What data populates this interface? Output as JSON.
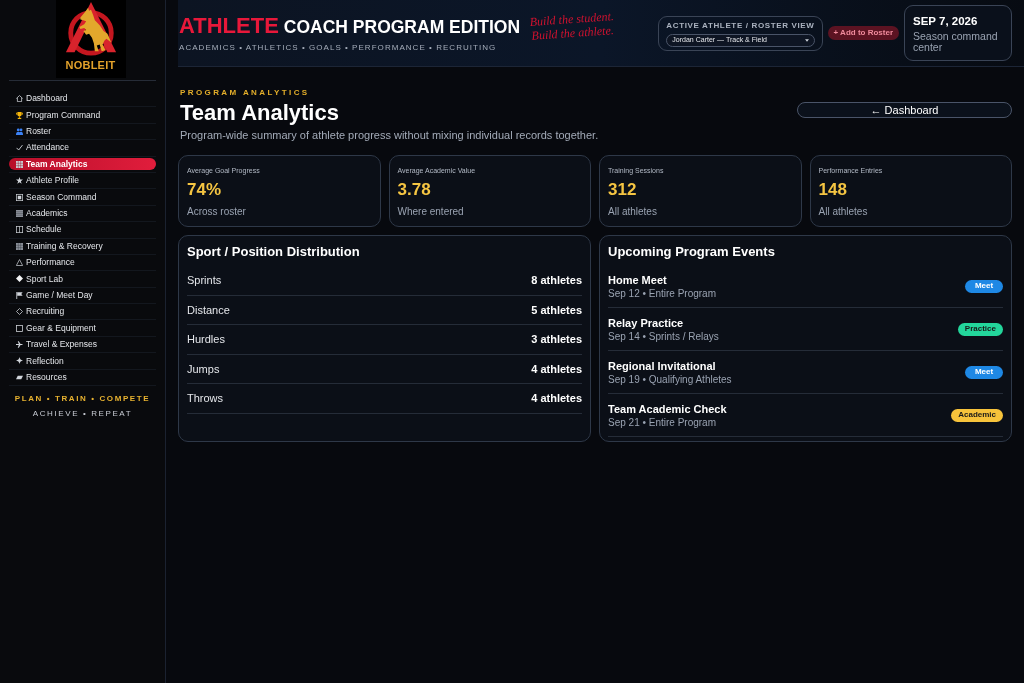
{
  "brand": {
    "logo_text": "NOBLEIT"
  },
  "sidebar": {
    "items": [
      {
        "label": "Dashboard",
        "selected": false
      },
      {
        "label": "Program Command",
        "selected": false
      },
      {
        "label": "Roster",
        "selected": false
      },
      {
        "label": "Attendance",
        "selected": false
      },
      {
        "label": "Team Analytics",
        "selected": true
      },
      {
        "label": "Athlete Profile",
        "selected": false
      },
      {
        "label": "Season Command",
        "selected": false
      },
      {
        "label": "Academics",
        "selected": false
      },
      {
        "label": "Schedule",
        "selected": false
      },
      {
        "label": "Training & Recovery",
        "selected": false
      },
      {
        "label": "Performance",
        "selected": false
      },
      {
        "label": "Sport Lab",
        "selected": false
      },
      {
        "label": "Game / Meet Day",
        "selected": false
      },
      {
        "label": "Recruiting",
        "selected": false
      },
      {
        "label": "Gear & Equipment",
        "selected": false
      },
      {
        "label": "Travel & Expenses",
        "selected": false
      },
      {
        "label": "Reflection",
        "selected": false
      },
      {
        "label": "Resources",
        "selected": false
      }
    ],
    "motto": [
      "PLAN • TRAIN • COMPETE",
      "ACHIEVE • REPEAT"
    ]
  },
  "header": {
    "title_accent": "ATHLETE",
    "title": "COACH PROGRAM EDITION",
    "subtitle": "ACADEMICS • ATHLETICS • GOALS • PERFORMANCE • RECRUITING",
    "tagline": [
      "Build the student.",
      "Build the athlete."
    ],
    "roster": {
      "label": "ACTIVE ATHLETE / ROSTER VIEW",
      "value": "Jordan Carter — Track & Field"
    },
    "add_button": "+ Add to Roster",
    "date": "SEP 7, 2026",
    "date_note": "Season command center"
  },
  "page": {
    "eyebrow": "PROGRAM ANALYTICS",
    "title": "Team Analytics",
    "description": "Program-wide summary of athlete progress without mixing individual records together.",
    "back_button": "← Dashboard"
  },
  "stats": [
    {
      "label": "Average Goal Progress",
      "value": "74%",
      "note": "Across roster"
    },
    {
      "label": "Average Academic Value",
      "value": "3.78",
      "note": "Where entered"
    },
    {
      "label": "Training Sessions",
      "value": "312",
      "note": "All athletes"
    },
    {
      "label": "Performance Entries",
      "value": "148",
      "note": "All athletes"
    }
  ],
  "distribution": {
    "title": "Sport / Position Distribution",
    "rows": [
      {
        "label": "Sprints",
        "value": "8 athletes"
      },
      {
        "label": "Distance",
        "value": "5 athletes"
      },
      {
        "label": "Hurdles",
        "value": "3 athletes"
      },
      {
        "label": "Jumps",
        "value": "4 athletes"
      },
      {
        "label": "Throws",
        "value": "4 athletes"
      }
    ]
  },
  "events": {
    "title": "Upcoming Program Events",
    "items": [
      {
        "title": "Home Meet",
        "detail": "Sep 12 • Entire Program",
        "tag": "Meet",
        "color": "#1e88e5"
      },
      {
        "title": "Relay Practice",
        "detail": "Sep 14 • Sprints / Relays",
        "tag": "Practice",
        "color": "#23d69b"
      },
      {
        "title": "Regional Invitational",
        "detail": "Sep 19 • Qualifying Athletes",
        "tag": "Meet",
        "color": "#1e88e5"
      },
      {
        "title": "Team Academic Check",
        "detail": "Sep 21 • Entire Program",
        "tag": "Academic",
        "color": "#f7c33b"
      }
    ]
  }
}
